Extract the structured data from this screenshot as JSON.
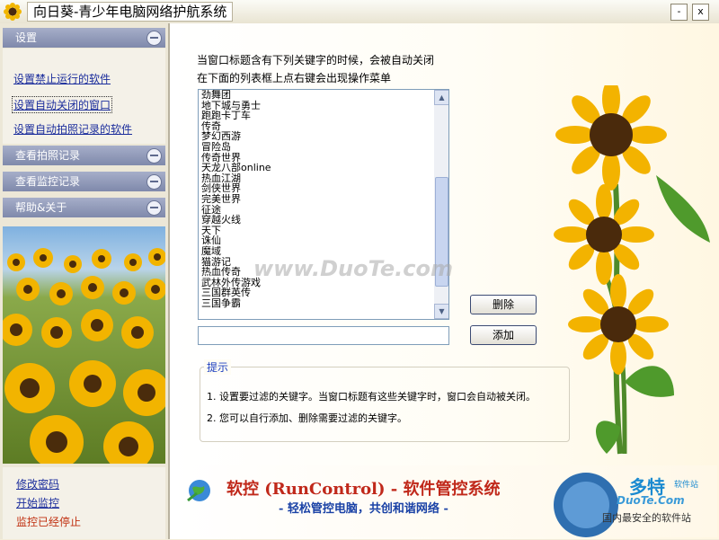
{
  "window": {
    "title": "向日葵-青少年电脑网络护航系统",
    "minimize_label": "-",
    "close_label": "x"
  },
  "sidebar": {
    "sections": [
      {
        "label": "设置"
      },
      {
        "label": "查看拍照记录"
      },
      {
        "label": "查看监控记录"
      },
      {
        "label": "帮助&关于"
      }
    ],
    "settings_links": [
      "设置禁止运行的软件",
      "设置自动关闭的窗口",
      "设置自动拍照记录的软件"
    ],
    "bottom_links": {
      "change_password": "修改密码",
      "start_monitor": "开始监控",
      "status": "监控已经停止"
    }
  },
  "main": {
    "desc_line1": "当窗口标题含有下列关键字的时候，会被自动关闭",
    "desc_line2": "在下面的列表框上点右键会出现操作菜单",
    "keywords": [
      "劲舞团",
      "地下城与勇士",
      "跑跑卡丁车",
      "传奇",
      "梦幻西游",
      "冒险岛",
      "传奇世界",
      "天龙八部online",
      "热血江湖",
      "剑侠世界",
      "完美世界",
      "征途",
      "穿越火线",
      "天下",
      "诛仙",
      "魔域",
      "猫游记",
      "热血传奇",
      "武林外传游戏",
      "三国群英传",
      "三国争霸"
    ],
    "keyword_input_value": "",
    "delete_button": "删除",
    "add_button": "添加",
    "hint_title": "提示",
    "hint_line1": "1. 设置要过滤的关键字。当窗口标题有这些关键字时，窗口会自动被关闭。",
    "hint_line2": "2. 您可以自行添加、删除需要过滤的关键字。"
  },
  "banner": {
    "title": "软控 (RunControl) - 软件管控系统",
    "subtitle": "- 轻松管控电脑，共创和谐网络 -"
  },
  "watermark": "www.DuoTe.com",
  "logo": {
    "name": "多特",
    "sub": "软件站",
    "url": "DuoTe.Com",
    "tagline": "国内最安全的软件站"
  },
  "colors": {
    "accent_header": "#8c95b6",
    "link": "#1b2d9c",
    "hint_title": "#1e40c0",
    "banner_red": "#c0281a",
    "banner_blue": "#1a42a6"
  }
}
